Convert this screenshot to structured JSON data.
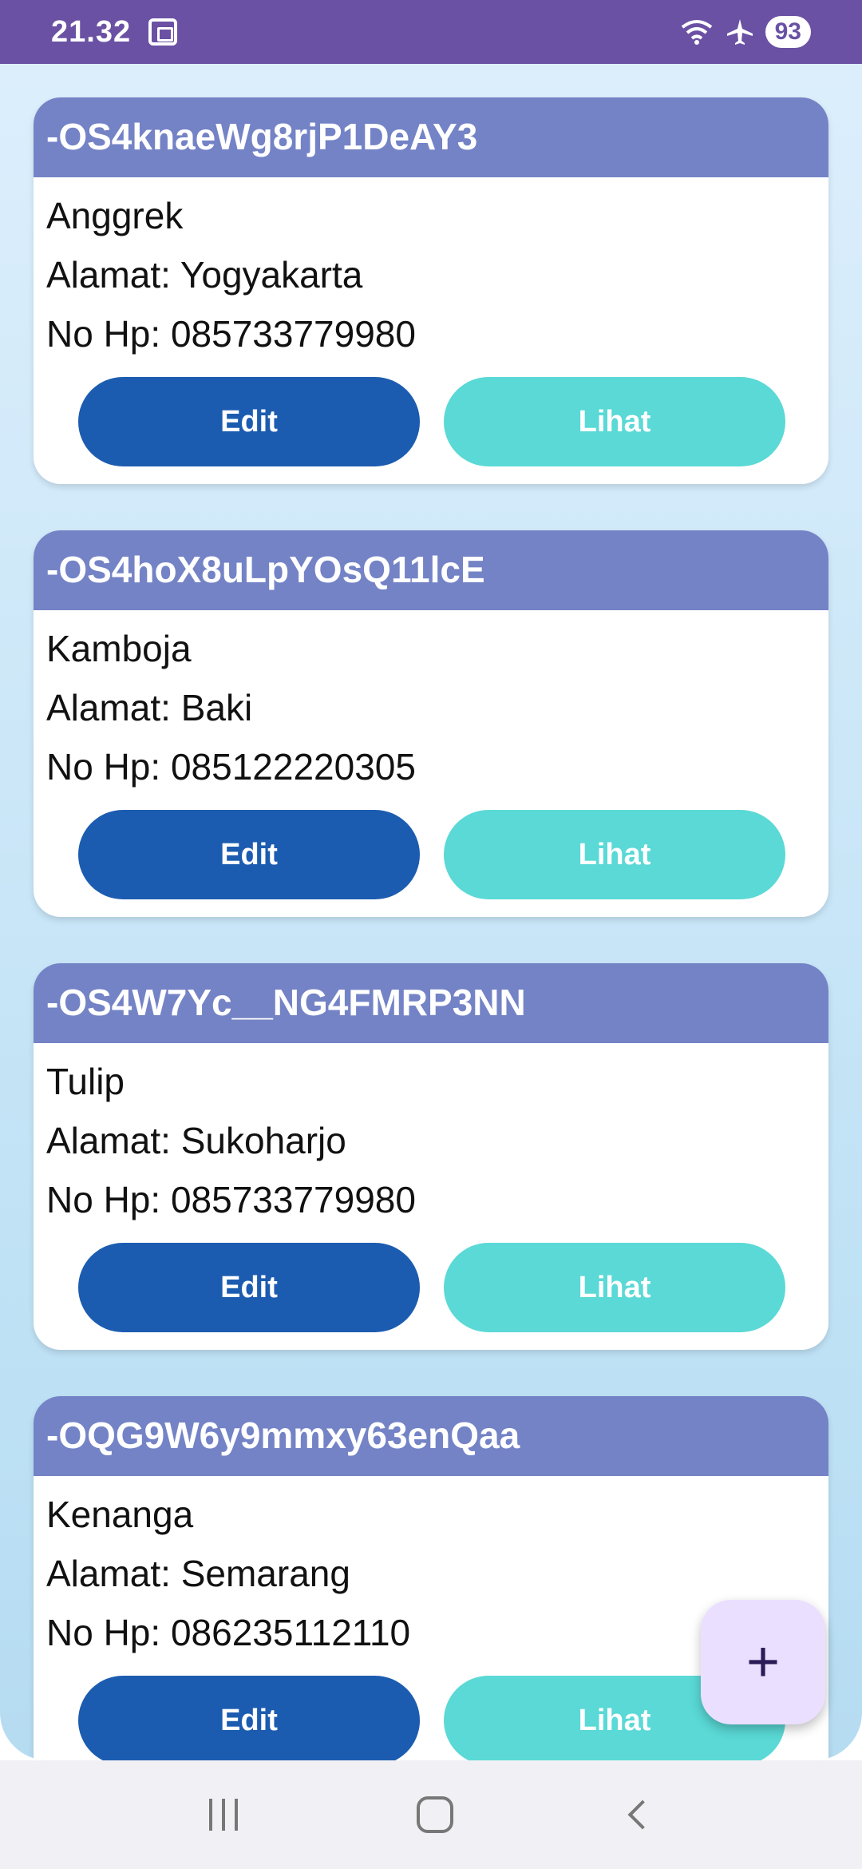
{
  "status_bar": {
    "time": "21.32",
    "battery": "93",
    "color": "#6a51a4"
  },
  "cards": [
    {
      "id": "-OS4knaeWg8rjP1DeAY3",
      "name": "Anggrek",
      "address": "Alamat: Yogyakarta",
      "phone": "No Hp: 085733779980",
      "edit_label": "Edit",
      "view_label": "Lihat"
    },
    {
      "id": "-OS4hoX8uLpYOsQ11lcE",
      "name": "Kamboja",
      "address": "Alamat: Baki",
      "phone": "No Hp: 085122220305",
      "edit_label": "Edit",
      "view_label": "Lihat"
    },
    {
      "id": "-OS4W7Yc__NG4FMRP3NN",
      "name": "Tulip",
      "address": "Alamat: Sukoharjo",
      "phone": "No Hp: 085733779980",
      "edit_label": "Edit",
      "view_label": "Lihat"
    },
    {
      "id": "-OQG9W6y9mmxy63enQaa",
      "name": "Kenanga",
      "address": "Alamat: Semarang",
      "phone": "No Hp: 086235112110",
      "edit_label": "Edit",
      "view_label": "Lihat"
    }
  ],
  "fab": {
    "icon": "plus-icon",
    "label": "+"
  },
  "colors": {
    "card_header": "#7483c6",
    "edit_button": "#1c5cb0",
    "view_button": "#5ad9d6",
    "fab_background": "#ebdfff"
  }
}
